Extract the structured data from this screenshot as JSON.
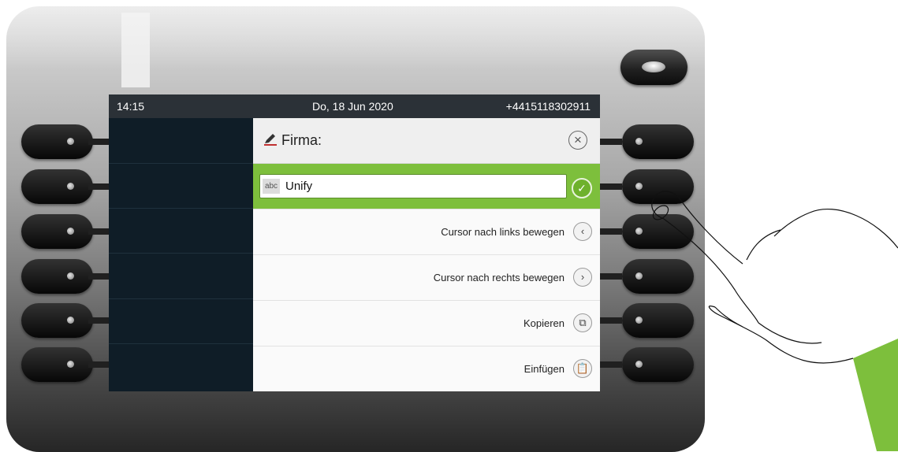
{
  "status_bar": {
    "time": "14:15",
    "date": "Do, 18 Jun 2020",
    "phone_number": "+4415118302911"
  },
  "dialog": {
    "title": "Firma:",
    "title_icon": "pencil-icon",
    "close_icon": "close-icon"
  },
  "input": {
    "type_badge": "abc",
    "value": "Unify",
    "confirm_icon": "check-icon"
  },
  "options": [
    {
      "label": "Cursor nach links bewegen",
      "icon": "chevron-left-icon",
      "glyph": "‹"
    },
    {
      "label": "Cursor nach rechts bewegen",
      "icon": "chevron-right-icon",
      "glyph": "›"
    },
    {
      "label": "Kopieren",
      "icon": "copy-icon",
      "glyph": "⧉"
    },
    {
      "label": "Einfügen",
      "icon": "paste-icon",
      "glyph": "📋"
    }
  ],
  "colors": {
    "accent_green": "#7dbf3c",
    "screen_dark": "#0c1820",
    "status_bar": "#2b3137"
  }
}
